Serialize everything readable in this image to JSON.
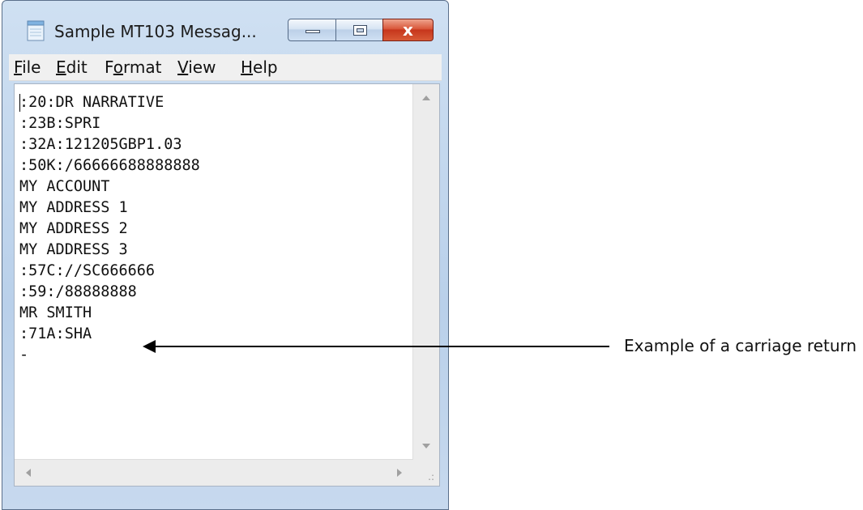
{
  "window": {
    "title": "Sample MT103 Messag...",
    "close_glyph": "x"
  },
  "menu": {
    "file": {
      "key": "F",
      "rest": "ile"
    },
    "edit": {
      "key": "E",
      "rest": "dit"
    },
    "format": {
      "pre": "F",
      "key": "o",
      "rest": "rmat"
    },
    "view": {
      "key": "V",
      "rest": "iew"
    },
    "help": {
      "key": "H",
      "rest": "elp"
    }
  },
  "document": {
    "text": ":20:DR NARRATIVE\n:23B:SPRI\n:32A:121205GBP1.03\n:50K:/66666688888888\nMY ACCOUNT\nMY ADDRESS 1\nMY ADDRESS 2\nMY ADDRESS 3\n:57C://SC666666\n:59:/88888888\nMR SMITH\n:71A:SHA\n-"
  },
  "annotation": {
    "label": "Example of a carriage return"
  },
  "icons": [
    "notepad-icon",
    "minimize-icon",
    "maximize-icon",
    "close-icon",
    "scroll-up-arrow-icon",
    "scroll-down-arrow-icon",
    "scroll-left-arrow-icon",
    "scroll-right-arrow-icon",
    "resize-grip-icon"
  ]
}
